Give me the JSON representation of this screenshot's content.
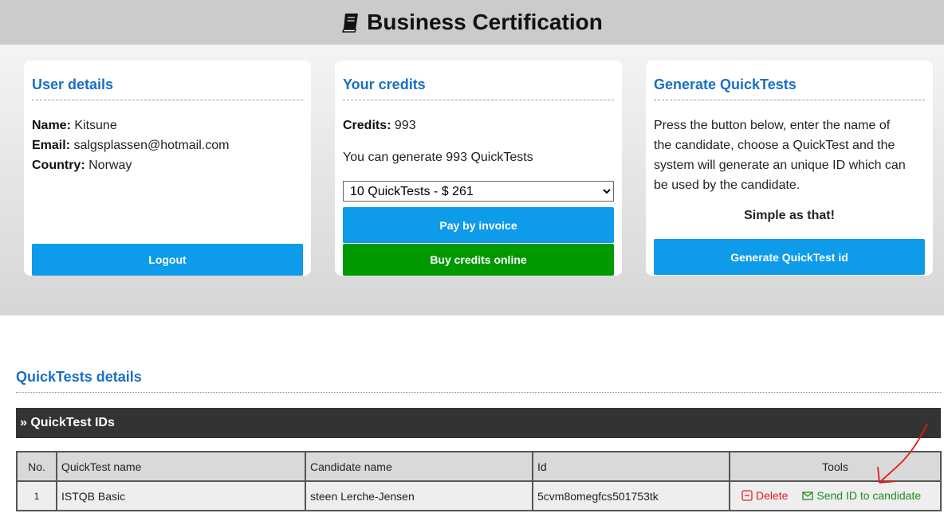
{
  "header": {
    "title": "Business Certification"
  },
  "user_card": {
    "title": "User details",
    "name_label": "Name:",
    "name_value": "Kitsune",
    "email_label": "Email:",
    "email_value": "salgsplassen@hotmail.com",
    "country_label": "Country:",
    "country_value": "Norway",
    "logout_label": "Logout"
  },
  "credits_card": {
    "title": "Your credits",
    "credits_label": "Credits:",
    "credits_value": "993",
    "generate_text": "You can generate 993 QuickTests",
    "package_selected": "10 QuickTests - $ 261",
    "pay_invoice_label": "Pay by invoice",
    "buy_online_label": "Buy credits online"
  },
  "generate_card": {
    "title": "Generate QuickTests",
    "description": "Press the button below, enter the name of the candidate, choose a QuickTest and the system will generate an unique ID which can be used by the candidate.",
    "tagline": "Simple as that!",
    "generate_label": "Generate QuickTest id"
  },
  "details": {
    "title": "QuickTests details",
    "bar_label": "» QuickTest IDs",
    "columns": [
      "No.",
      "QuickTest name",
      "Candidate name",
      "Id",
      "Tools"
    ],
    "rows": [
      {
        "no": "1",
        "quicktest": "ISTQB Basic",
        "candidate": "steen Lerche-Jensen",
        "id": "5cvm8omegfcs501753tk",
        "delete_label": "Delete",
        "send_label": "Send ID to candidate"
      }
    ]
  },
  "colors": {
    "accent_blue": "#0d9bea",
    "heading_blue": "#1a6fc4",
    "buy_green": "#009900",
    "delete_red": "#e02020",
    "send_green": "#228b22"
  },
  "icons": [
    "book-icon",
    "minus-square-icon",
    "envelope-icon"
  ]
}
